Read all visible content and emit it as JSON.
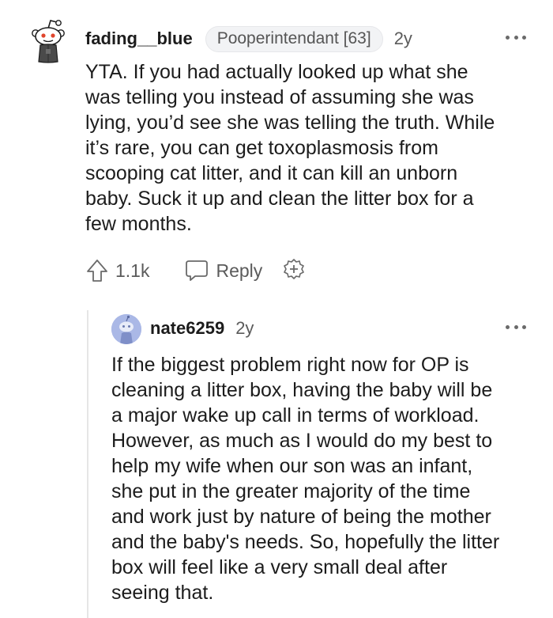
{
  "comments": [
    {
      "username": "fading__blue",
      "flair": "Pooperintendant [63]",
      "age": "2y",
      "body": "YTA. If you had actually looked up what she\nwas telling you instead of assuming she was\nlying, you’d see she was telling the truth. While\nit’s rare, you can get toxoplasmosis from\nscooping cat litter, and it can kill an unborn\nbaby. Suck it up and clean the litter box for a\nfew months.",
      "upvotes": "1.1k",
      "reply_label": "Reply",
      "avatar_icon": "snoo-avatar-icon"
    },
    {
      "username": "nate6259",
      "age": "2y",
      "body": "If the biggest problem right now for OP is\ncleaning a litter box, having the baby will be\na major wake up call in terms of workload.\nHowever, as much as I would do my best to\nhelp my wife when our son was an infant,\nshe put in the greater majority of the time\nand work just by nature of being the mother\nand the baby's needs. So, hopefully the litter\nbox will feel like a very small deal after\nseeing that.",
      "avatar_icon": "default-avatar-icon"
    }
  ],
  "icons": {
    "upvote": "upvote-arrow-icon",
    "reply": "speech-bubble-icon",
    "award": "award-plus-icon",
    "more": "more-options-icon"
  },
  "colors": {
    "text": "#1c1c1c",
    "muted": "#5b5b5b",
    "flair_bg": "#f2f3f5",
    "avatar_bg": "#aab8e6",
    "thread_line": "#e6e6e6"
  }
}
